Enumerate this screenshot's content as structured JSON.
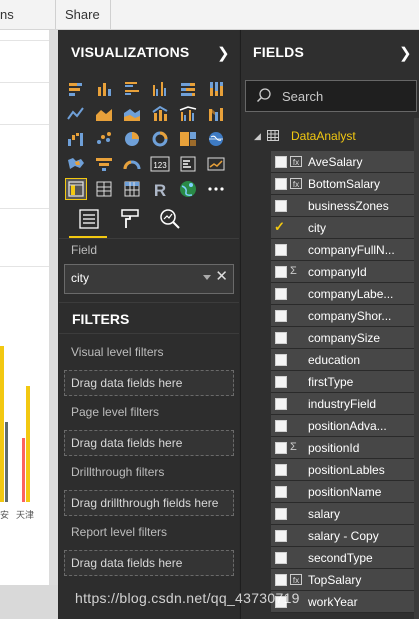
{
  "topbar": {
    "tab_left": "ns",
    "tab_share": "Share"
  },
  "canvas": {
    "x_labels": [
      "安",
      "天津"
    ],
    "bar_colors": {
      "yellow": "#f2c811",
      "red": "#fd625e",
      "gray": "#5f6b6d"
    }
  },
  "viz_pane": {
    "title": "VISUALIZATIONS",
    "icons": [
      "stacked-bar-chart",
      "stacked-column-chart",
      "clustered-bar-chart",
      "clustered-column-chart",
      "100-percent-bar-chart",
      "100-percent-column-chart",
      "line-chart",
      "area-chart",
      "stacked-area-chart",
      "line-and-column-chart",
      "line-and-clustered-column-chart",
      "ribbon-chart",
      "waterfall-chart",
      "scatter-chart",
      "pie-chart",
      "donut-chart",
      "treemap",
      "map",
      "filled-map",
      "funnel-chart",
      "gauge",
      "card",
      "multi-row-card",
      "kpi",
      "slicer",
      "table",
      "matrix",
      "r-script-visual",
      "globe-map",
      "more-visuals"
    ],
    "selected_icon": "slicer",
    "field_label": "Field",
    "field_value": "city"
  },
  "filters": {
    "title": "FILTERS",
    "visual_level_label": "Visual level filters",
    "visual_level_drop": "Drag data fields here",
    "page_level_label": "Page level filters",
    "page_level_drop": "Drag data fields here",
    "drillthrough_label": "Drillthrough filters",
    "drillthrough_drop": "Drag drillthrough fields here",
    "report_level_label": "Report level filters",
    "report_level_drop": "Drag data fields here"
  },
  "fields_pane": {
    "title": "FIELDS",
    "search_placeholder": "Search",
    "table_name": "DataAnalyst",
    "fields": [
      {
        "name": "AveSalary",
        "icon": "calc-column-icon",
        "checked": false
      },
      {
        "name": "BottomSalary",
        "icon": "calc-column-icon",
        "checked": false
      },
      {
        "name": "businessZones",
        "icon": "",
        "checked": false
      },
      {
        "name": "city",
        "icon": "",
        "checked": true
      },
      {
        "name": "companyFullN...",
        "icon": "",
        "checked": false
      },
      {
        "name": "companyId",
        "icon": "sigma-icon",
        "checked": false
      },
      {
        "name": "companyLabe...",
        "icon": "",
        "checked": false
      },
      {
        "name": "companyShor...",
        "icon": "",
        "checked": false
      },
      {
        "name": "companySize",
        "icon": "",
        "checked": false
      },
      {
        "name": "education",
        "icon": "",
        "checked": false
      },
      {
        "name": "firstType",
        "icon": "",
        "checked": false
      },
      {
        "name": "industryField",
        "icon": "",
        "checked": false
      },
      {
        "name": "positionAdva...",
        "icon": "",
        "checked": false
      },
      {
        "name": "positionId",
        "icon": "sigma-icon",
        "checked": false
      },
      {
        "name": "positionLables",
        "icon": "",
        "checked": false
      },
      {
        "name": "positionName",
        "icon": "",
        "checked": false
      },
      {
        "name": "salary",
        "icon": "",
        "checked": false
      },
      {
        "name": "salary - Copy",
        "icon": "",
        "checked": false
      },
      {
        "name": "secondType",
        "icon": "",
        "checked": false
      },
      {
        "name": "TopSalary",
        "icon": "calc-column-icon",
        "checked": false
      },
      {
        "name": "workYear",
        "icon": "",
        "checked": false
      }
    ]
  },
  "watermark": "https://blog.csdn.net/qq_43730719",
  "colors": {
    "accent": "#f2c811",
    "pane_bg": "#2d2d2d"
  }
}
